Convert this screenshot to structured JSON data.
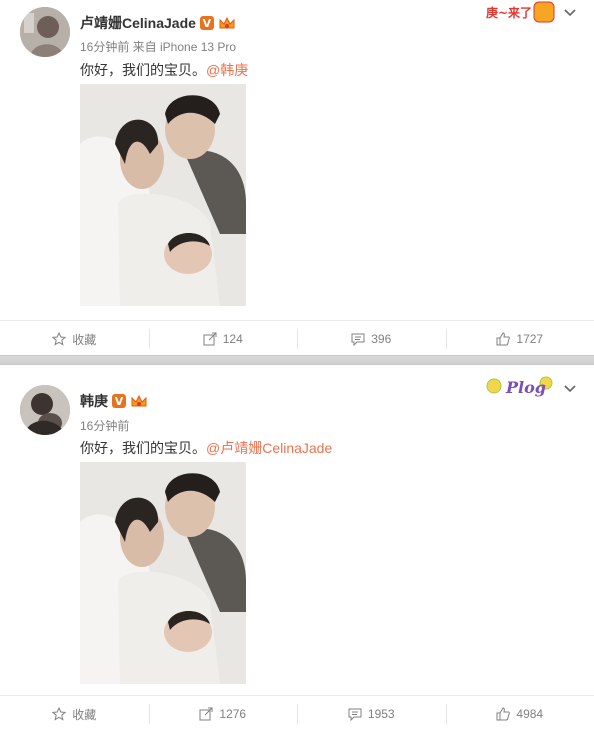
{
  "posts": [
    {
      "author": "卢靖姗CelinaJade",
      "verified_badge": "V",
      "meta": "16分钟前 来自 iPhone 13 Pro",
      "text": "你好，我们的宝贝。",
      "mention": "@韩庚",
      "sticker_text": "庚~来了",
      "actions": {
        "favorite": "收藏",
        "repost": "124",
        "comment": "396",
        "like": "1727"
      }
    },
    {
      "author": "韩庚",
      "verified_badge": "V",
      "meta": "16分钟前",
      "text": "你好，我们的宝贝。",
      "mention": "@卢靖姗CelinaJade",
      "sticker_text": "Plog",
      "actions": {
        "favorite": "收藏",
        "repost": "1276",
        "comment": "1953",
        "like": "4984"
      }
    }
  ],
  "colors": {
    "mention": "#eb7350",
    "verified": "#e8731f",
    "meta": "#808080"
  }
}
